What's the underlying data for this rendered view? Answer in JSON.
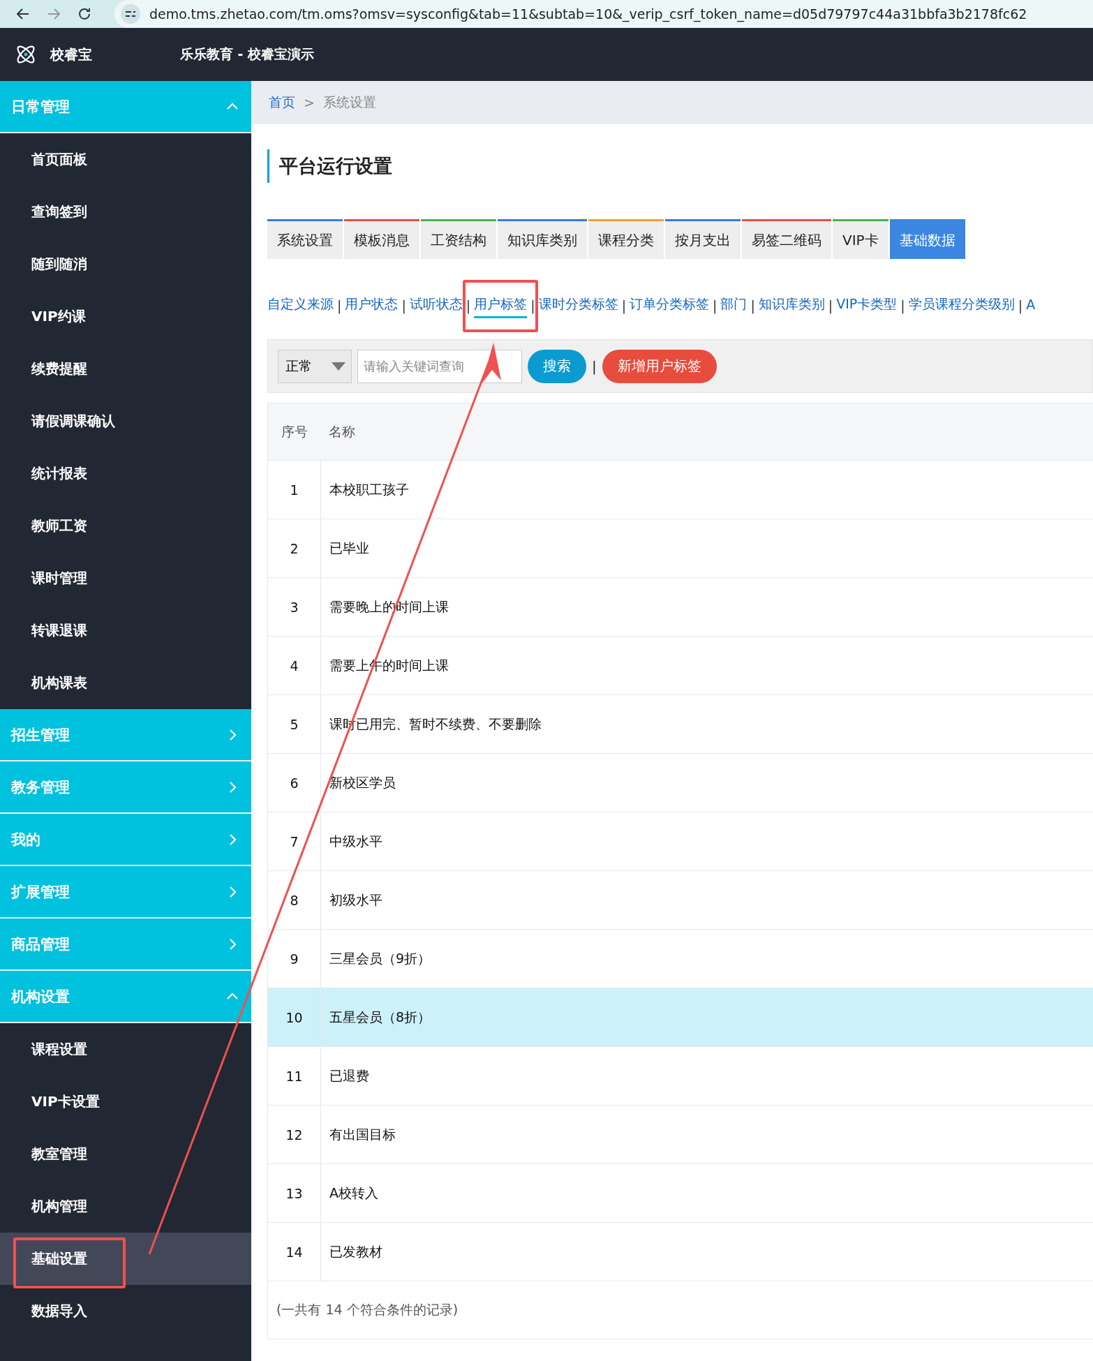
{
  "browser": {
    "url": "demo.tms.zhetao.com/tm.oms?omsv=sysconfig&tab=11&subtab=10&_verip_csrf_token_name=d05d79797c44a31bbfa3b2178fc62"
  },
  "header": {
    "brand": "校睿宝",
    "org": "乐乐教育 - 校睿宝演示"
  },
  "sidebar": [
    {
      "label": "日常管理",
      "expanded": true,
      "children": [
        {
          "label": "首页面板",
          "selected": false
        },
        {
          "label": "查询签到",
          "selected": false
        },
        {
          "label": "随到随消",
          "selected": false
        },
        {
          "label": "VIP约课",
          "selected": false
        },
        {
          "label": "续费提醒",
          "selected": false
        },
        {
          "label": "请假调课确认",
          "selected": false
        },
        {
          "label": "统计报表",
          "selected": false
        },
        {
          "label": "教师工资",
          "selected": false
        },
        {
          "label": "课时管理",
          "selected": false
        },
        {
          "label": "转课退课",
          "selected": false
        },
        {
          "label": "机构课表",
          "selected": false
        }
      ]
    },
    {
      "label": "招生管理",
      "expanded": false
    },
    {
      "label": "教务管理",
      "expanded": false
    },
    {
      "label": "我的",
      "expanded": false
    },
    {
      "label": "扩展管理",
      "expanded": false
    },
    {
      "label": "商品管理",
      "expanded": false
    },
    {
      "label": "机构设置",
      "expanded": true,
      "children": [
        {
          "label": "课程设置",
          "selected": false
        },
        {
          "label": "VIP卡设置",
          "selected": false
        },
        {
          "label": "教室管理",
          "selected": false
        },
        {
          "label": "机构管理",
          "selected": false
        },
        {
          "label": "基础设置",
          "selected": true
        },
        {
          "label": "数据导入",
          "selected": false
        }
      ]
    }
  ],
  "breadcrumb": {
    "home": "首页",
    "separator": ">",
    "current": "系统设置"
  },
  "page_title": "平台运行设置",
  "tabs": [
    {
      "label": "系统设置",
      "selected": false,
      "color": "#3a7bd5"
    },
    {
      "label": "模板消息",
      "selected": false,
      "color": "#e05050"
    },
    {
      "label": "工资结构",
      "selected": false,
      "color": "#4caf50"
    },
    {
      "label": "知识库类别",
      "selected": false,
      "color": "#3a7bd5"
    },
    {
      "label": "课程分类",
      "selected": false,
      "color": "#f0a030"
    },
    {
      "label": "按月支出",
      "selected": false,
      "color": "#3a7bd5"
    },
    {
      "label": "易签二维码",
      "selected": false,
      "color": "#e05050"
    },
    {
      "label": "VIP卡",
      "selected": false,
      "color": "#4caf50"
    },
    {
      "label": "基础数据",
      "selected": true,
      "color": "#3a86e0"
    }
  ],
  "subtabs": [
    {
      "label": "自定义来源",
      "selected": false,
      "separator": "|"
    },
    {
      "label": "用户状态",
      "selected": false,
      "separator": "|"
    },
    {
      "label": "试听状态",
      "selected": false,
      "separator": "|"
    },
    {
      "label": "用户标签",
      "selected": true,
      "separator": "|"
    },
    {
      "label": "课时分类标签",
      "selected": false,
      "separator": "|"
    },
    {
      "label": "订单分类标签",
      "selected": false,
      "separator": "|"
    },
    {
      "label": "部门",
      "selected": false,
      "separator": "|"
    },
    {
      "label": "知识库类别",
      "selected": false,
      "separator": "|"
    },
    {
      "label": "VIP卡类型",
      "selected": false,
      "separator": "|"
    },
    {
      "label": "学员课程分类级别",
      "selected": false,
      "separator": "|"
    },
    {
      "label": "A",
      "selected": false
    }
  ],
  "toolbar": {
    "status_select": "正常",
    "search": {
      "placeholder": "请输入关键词查询"
    },
    "search_button": "搜索",
    "divider": "|",
    "add_button": "新增用户标签"
  },
  "table": {
    "columns": [
      "序号",
      "名称"
    ],
    "rows": [
      {
        "no": "1",
        "name": "本校职工孩子",
        "selected": false
      },
      {
        "no": "2",
        "name": "已毕业",
        "selected": false
      },
      {
        "no": "3",
        "name": "需要晚上的时间上课",
        "selected": false
      },
      {
        "no": "4",
        "name": "需要上午的时间上课",
        "selected": false
      },
      {
        "no": "5",
        "name": "课时已用完、暂时不续费、不要删除",
        "selected": false
      },
      {
        "no": "6",
        "name": "新校区学员",
        "selected": false
      },
      {
        "no": "7",
        "name": "中级水平",
        "selected": false
      },
      {
        "no": "8",
        "name": "初级水平",
        "selected": false
      },
      {
        "no": "9",
        "name": "三星会员（9折）",
        "selected": false
      },
      {
        "no": "10",
        "name": "五星会员（8折）",
        "selected": true
      },
      {
        "no": "11",
        "name": "已退费",
        "selected": false
      },
      {
        "no": "12",
        "name": "有出国目标",
        "selected": false
      },
      {
        "no": "13",
        "name": "A校转入",
        "selected": false
      },
      {
        "no": "14",
        "name": "已发教材",
        "selected": false
      }
    ],
    "footer": "(一共有 14 个符合条件的记录)"
  }
}
